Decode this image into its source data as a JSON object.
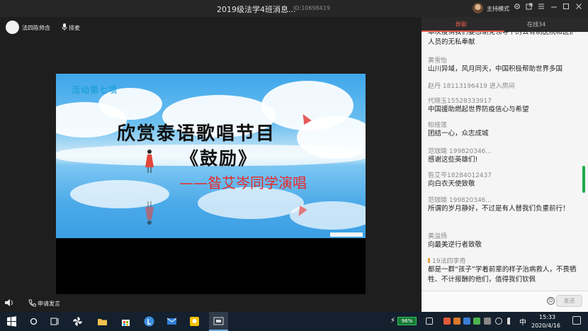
{
  "window": {
    "title": "2019级法学4班消息...",
    "room_id": "ID:10698419",
    "host_mode": "主持模式"
  },
  "presenter": {
    "name": "法四陈帅含",
    "queue_label": "排麦"
  },
  "slide": {
    "tag": "活动第七项",
    "line1": "欣赏泰语歌唱节目",
    "line2": "《鼓励》",
    "line3": "——昝艾岑同学演唱"
  },
  "bottom_bar": {
    "apply_label": "申请发言"
  },
  "panel": {
    "tabs": [
      "群聊",
      "在线34"
    ],
    "messages": [
      {
        "who": "",
        "text": "本次疫情我们要感谢党领导下的公有制医院和医护人员的无私奉献"
      },
      {
        "who": "黄雪怡",
        "text": "山川异域，风月同天，中国积极帮助世界多国"
      },
      {
        "who": "代晓玉15528333917",
        "text": "中国援助燃起世界防疫信心与希望"
      },
      {
        "who": "柏娅莲",
        "text": "团结一心，众志成城"
      },
      {
        "who": "范珈瑜  199820346...",
        "text": "感谢这些英雄们!"
      },
      {
        "who": "昝艾岑18284012437",
        "text": "向白衣天使致敬"
      },
      {
        "who": "范珈瑜  199820346...",
        "text": "所谓的岁月静好，不过是有人替我们负重前行！"
      },
      {
        "who": "黄溢扬",
        "text": "向最美逆行者致敬"
      },
      {
        "who": "19法四李奇",
        "text": "都是一群“孩子”学着前辈的样子治病救人，不畏牺牲、不计报酬的他们，值得我们钦佩"
      }
    ],
    "system_message": "赵丹 18113196419 进入房间",
    "send_label": "发送"
  },
  "taskbar": {
    "battery": "96%",
    "ime": "中",
    "time": "15:33",
    "date": "2020/4/16"
  },
  "colors": {
    "accent": "#e25a4a",
    "battery_green": "#2fc35a"
  }
}
